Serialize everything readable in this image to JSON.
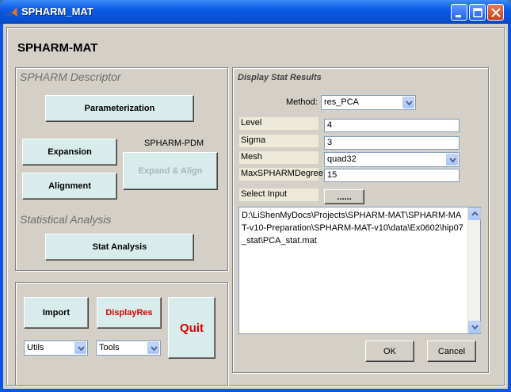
{
  "window": {
    "title": "SPHARM_MAT"
  },
  "header": {
    "title": "SPHARM-MAT"
  },
  "descriptor": {
    "heading": "SPHARM Descriptor",
    "parameterization": "Parameterization",
    "expansion": "Expansion",
    "alignment": "Alignment",
    "pdm_label": "SPHARM-PDM",
    "expand_align": "Expand & Align",
    "stat_heading": "Statistical Analysis",
    "stat_analysis": "Stat Analysis"
  },
  "bottom": {
    "import": "Import",
    "displayres": "DisplayRes",
    "quit": "Quit",
    "utils": "Utils",
    "tools": "Tools"
  },
  "display": {
    "heading": "Display Stat Results",
    "method_label": "Method:",
    "method_value": "res_PCA",
    "level_label": "Level",
    "level_value": "4",
    "sigma_label": "Sigma",
    "sigma_value": "3",
    "mesh_label": "Mesh",
    "mesh_value": "quad32",
    "maxdeg_label": "MaxSPHARMDegree",
    "maxdeg_value": "15",
    "select_input_label": "Select Input",
    "browse_button": "......",
    "input_path": "D:\\LiShenMyDocs\\Projects\\SPHARM-MAT\\SPHARM-MAT-v10-Preparation\\SPHARM-MAT-v10\\data\\Ex0602\\hip07_stat\\PCA_stat.mat",
    "ok": "OK",
    "cancel": "Cancel"
  },
  "colors": {
    "button_face": "#d9ecec",
    "window_bg": "#d4d0c8",
    "titlebar": "#0a5ae5",
    "red_text": "#e00000"
  }
}
